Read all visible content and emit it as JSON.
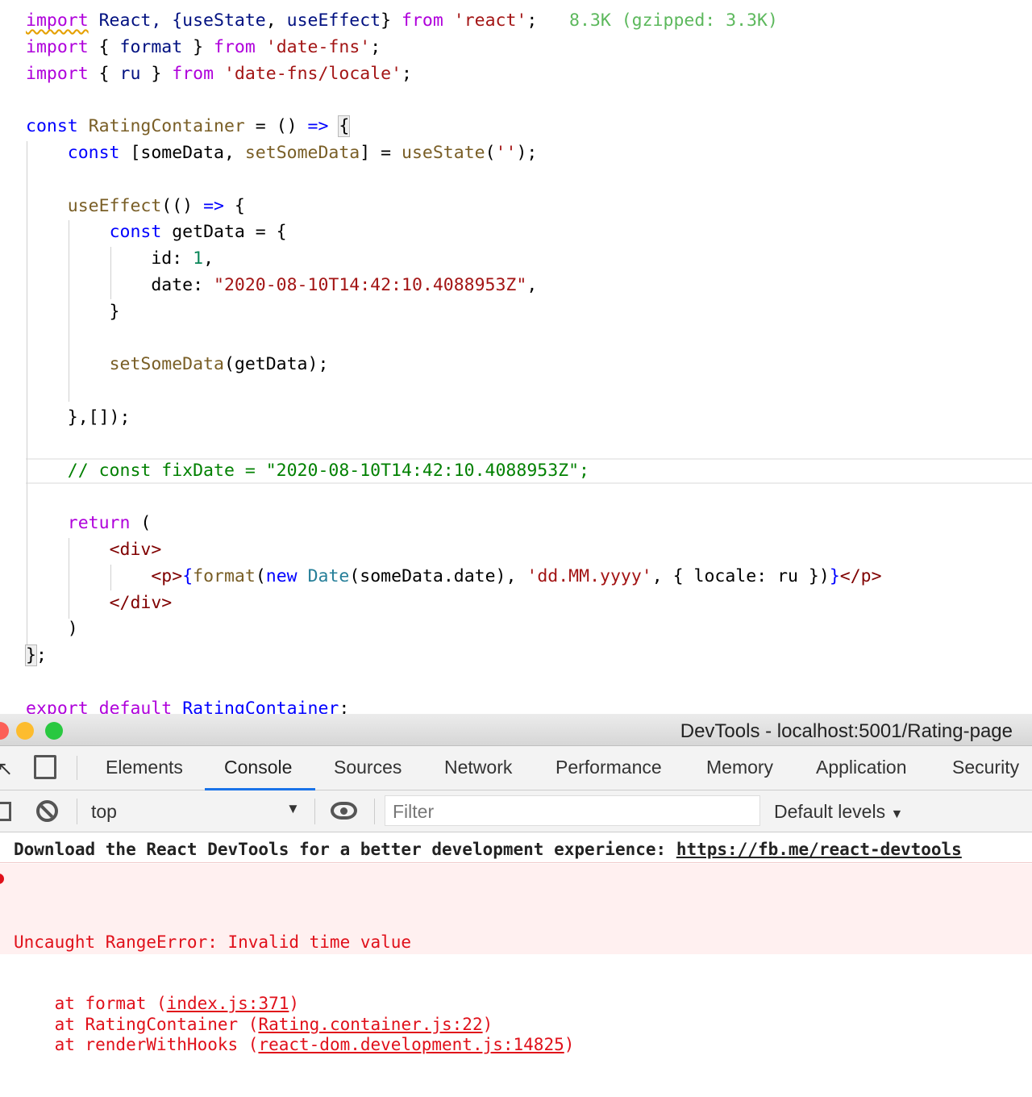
{
  "editor": {
    "bundle_size": "8.3K (gzipped: 3.3K)",
    "lines": [
      {
        "n": 0,
        "tokens": [
          [
            "import",
            "kw sq"
          ],
          [
            " React, {",
            "vr"
          ],
          [
            "useState",
            "vr"
          ],
          [
            ", ",
            "pl"
          ],
          [
            "useEffect",
            "vr"
          ],
          [
            "} ",
            "pl"
          ],
          [
            "from",
            "kw"
          ],
          [
            " ",
            "pl"
          ],
          [
            "'react'",
            "st"
          ],
          [
            ";",
            "pl"
          ]
        ]
      },
      {
        "n": 1,
        "tokens": [
          [
            "import",
            "kw"
          ],
          [
            " { ",
            "pl"
          ],
          [
            "format",
            "vr"
          ],
          [
            " } ",
            "pl"
          ],
          [
            "from",
            "kw"
          ],
          [
            " ",
            "pl"
          ],
          [
            "'date-fns'",
            "st"
          ],
          [
            ";",
            "pl"
          ]
        ]
      },
      {
        "n": 2,
        "tokens": [
          [
            "import",
            "kw"
          ],
          [
            " { ",
            "pl"
          ],
          [
            "ru",
            "vr"
          ],
          [
            " } ",
            "pl"
          ],
          [
            "from",
            "kw"
          ],
          [
            " ",
            "pl"
          ],
          [
            "'date-fns/locale'",
            "st"
          ],
          [
            ";",
            "pl"
          ]
        ]
      },
      {
        "n": 4,
        "tokens": [
          [
            "const",
            "cn"
          ],
          [
            " ",
            "pl"
          ],
          [
            "RatingContainer",
            "fn"
          ],
          [
            " = () ",
            "pl"
          ],
          [
            "=>",
            "cn"
          ],
          [
            " ",
            "pl"
          ],
          [
            "{",
            "pl bm"
          ]
        ]
      },
      {
        "n": 5,
        "tokens": [
          [
            "    ",
            "pl"
          ],
          [
            "const",
            "cn"
          ],
          [
            " [someData, ",
            "pl"
          ],
          [
            "setSomeData",
            "fn"
          ],
          [
            "] = ",
            "pl"
          ],
          [
            "useState",
            "fn"
          ],
          [
            "(",
            "pl"
          ],
          [
            "''",
            "st"
          ],
          [
            ");",
            "pl"
          ]
        ]
      },
      {
        "n": 7,
        "tokens": [
          [
            "    ",
            "pl"
          ],
          [
            "useEffect",
            "fn"
          ],
          [
            "(() ",
            "pl"
          ],
          [
            "=>",
            "cn"
          ],
          [
            " {",
            "pl"
          ]
        ]
      },
      {
        "n": 8,
        "tokens": [
          [
            "        ",
            "pl"
          ],
          [
            "const",
            "cn"
          ],
          [
            " getData = {",
            "pl"
          ]
        ]
      },
      {
        "n": 9,
        "tokens": [
          [
            "            id: ",
            "pl"
          ],
          [
            "1",
            "nm"
          ],
          [
            ",",
            "pl"
          ]
        ]
      },
      {
        "n": 10,
        "tokens": [
          [
            "            date: ",
            "pl"
          ],
          [
            "\"2020-08-10T14:42:10.4088953Z\"",
            "st"
          ],
          [
            ",",
            "pl"
          ]
        ]
      },
      {
        "n": 11,
        "tokens": [
          [
            "        }",
            "pl"
          ]
        ]
      },
      {
        "n": 13,
        "tokens": [
          [
            "        ",
            "pl"
          ],
          [
            "setSomeData",
            "fn"
          ],
          [
            "(getData);",
            "pl"
          ]
        ]
      },
      {
        "n": 15,
        "tokens": [
          [
            "    },[]);",
            "pl"
          ]
        ]
      },
      {
        "n": 17,
        "tokens": [
          [
            "    ",
            "pl"
          ],
          [
            "// const fixDate = \"2020-08-10T14:42:10.4088953Z\";",
            "cm"
          ]
        ]
      },
      {
        "n": 19,
        "tokens": [
          [
            "    ",
            "pl"
          ],
          [
            "return",
            "kw"
          ],
          [
            " (",
            "pl"
          ]
        ]
      },
      {
        "n": 20,
        "tokens": [
          [
            "        ",
            "pl"
          ],
          [
            "<div>",
            "tg"
          ]
        ]
      },
      {
        "n": 21,
        "tokens": [
          [
            "            ",
            "pl"
          ],
          [
            "<p>",
            "tg"
          ],
          [
            "{",
            "cn"
          ],
          [
            "format",
            "fn"
          ],
          [
            "(",
            "pl"
          ],
          [
            "new",
            "cn"
          ],
          [
            " ",
            "pl"
          ],
          [
            "Date",
            "ty"
          ],
          [
            "(someData.date), ",
            "pl"
          ],
          [
            "'dd.MM.yyyy'",
            "st"
          ],
          [
            ", { locale: ru })",
            "pl"
          ],
          [
            "}",
            "cn"
          ],
          [
            "</p>",
            "tg"
          ]
        ]
      },
      {
        "n": 22,
        "tokens": [
          [
            "        ",
            "pl"
          ],
          [
            "</div>",
            "tg"
          ]
        ]
      },
      {
        "n": 23,
        "tokens": [
          [
            "    )",
            "pl"
          ]
        ]
      },
      {
        "n": 24,
        "tokens": [
          [
            "}",
            "pl bm"
          ],
          [
            ";",
            "pl"
          ]
        ]
      },
      {
        "n": 26,
        "tokens": [
          [
            "export",
            "kw"
          ],
          [
            " ",
            "pl"
          ],
          [
            "default",
            "kw"
          ],
          [
            " ",
            "pl"
          ],
          [
            "RatingContainer",
            "cn"
          ],
          [
            ";",
            "pl"
          ]
        ]
      }
    ]
  },
  "devtools": {
    "title": "DevTools - localhost:5001/Rating-page",
    "tabs": [
      "Elements",
      "Console",
      "Sources",
      "Network",
      "Performance",
      "Memory",
      "Application",
      "Security"
    ],
    "active_tab": "Console",
    "context": "top",
    "filter_placeholder": "Filter",
    "levels": "Default levels",
    "info_text": "Download the React DevTools for a better development experience: ",
    "info_link": "https://fb.me/react-devtools",
    "error": {
      "message": "Uncaught RangeError: Invalid time value",
      "stack": [
        {
          "prefix": "    at format (",
          "link": "index.js:371",
          "suffix": ")"
        },
        {
          "prefix": "    at RatingContainer (",
          "link": "Rating.container.js:22",
          "suffix": ")"
        },
        {
          "prefix": "    at renderWithHooks (",
          "link": "react-dom.development.js:14825",
          "suffix": ")"
        }
      ]
    }
  }
}
